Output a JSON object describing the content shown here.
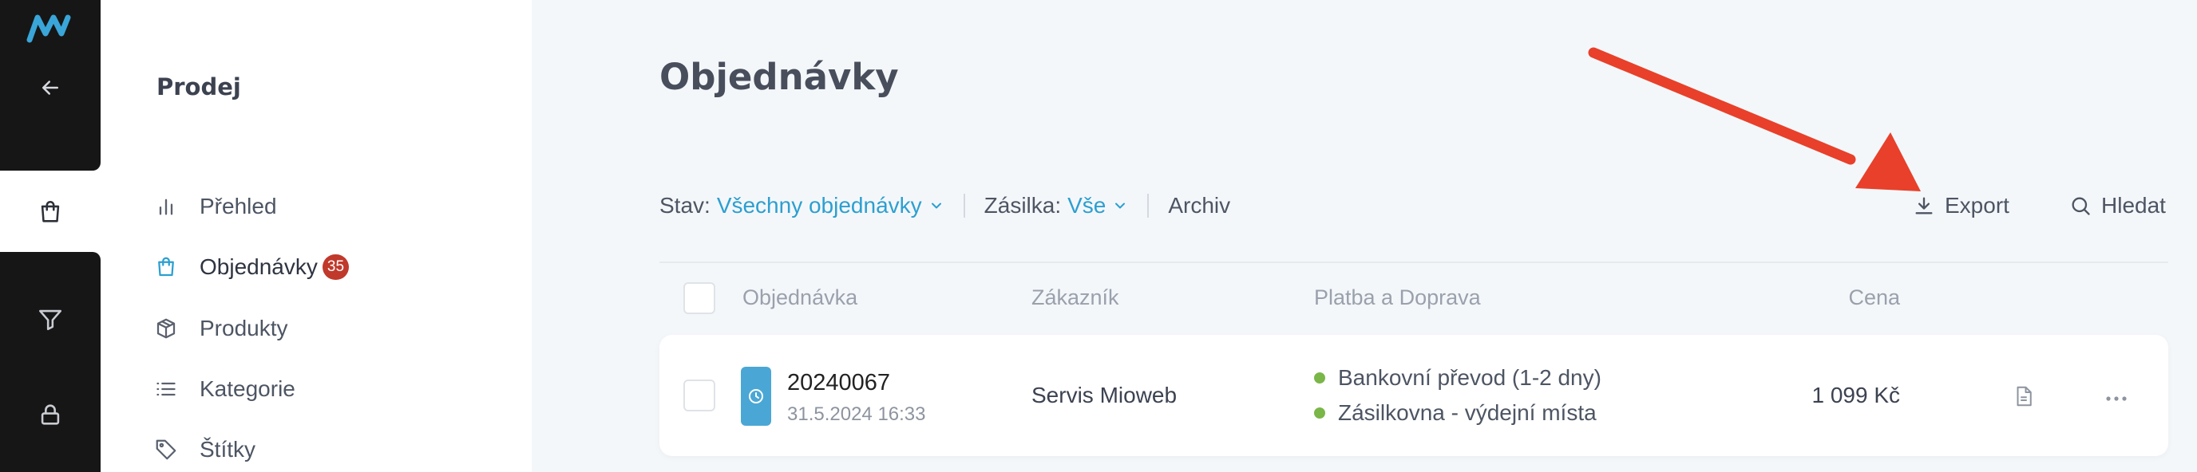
{
  "sidebar": {
    "title": "Prodej",
    "items": [
      {
        "label": "Přehled",
        "icon": "chart-icon"
      },
      {
        "label": "Objednávky",
        "icon": "shopping-bag-icon",
        "badge": "35"
      },
      {
        "label": "Produkty",
        "icon": "box-icon"
      },
      {
        "label": "Kategorie",
        "icon": "list-icon"
      },
      {
        "label": "Štítky",
        "icon": "tag-icon"
      }
    ]
  },
  "rail": {
    "icons": [
      "logo-icon",
      "back-arrow-icon",
      "shopping-bag-icon",
      "filter-icon",
      "lock-icon"
    ]
  },
  "main": {
    "title": "Objednávky",
    "filters": {
      "status_label": "Stav:",
      "status_value": "Všechny objednávky",
      "shipment_label": "Zásilka:",
      "shipment_value": "Vše",
      "archive_label": "Archiv"
    },
    "toolbar": {
      "export_label": "Export",
      "search_label": "Hledat"
    },
    "table": {
      "columns": [
        "Objednávka",
        "Zákazník",
        "Platba a Doprava",
        "Cena"
      ],
      "rows": [
        {
          "order": "20240067",
          "date": "31.5.2024 16:33",
          "customer": "Servis Mioweb",
          "payment": "Bankovní převod (1-2 dny)",
          "shipping": "Zásilkovna - výdejní místa",
          "price": "1 099 Kč"
        }
      ]
    }
  },
  "colors": {
    "accent": "#2d9fd0",
    "badge": "#c0392b",
    "status_dot": "#7ab648",
    "arrow": "#e8402a",
    "rail": "#161616"
  }
}
